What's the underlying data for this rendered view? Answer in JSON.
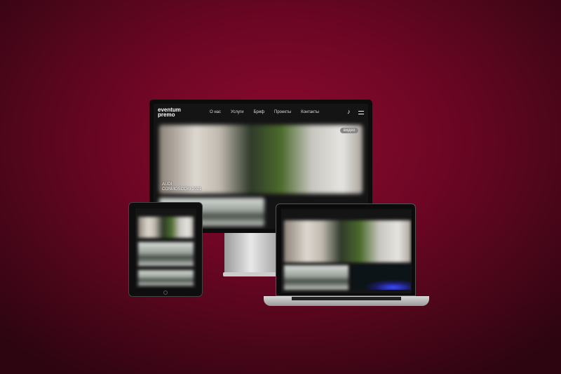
{
  "site": {
    "logo": "eventum premo",
    "nav": [
      "О нас",
      "Услуги",
      "Бриф",
      "Проекты",
      "Контакты"
    ],
    "hero_caption_line1": "AUDI",
    "hero_caption_line2": "COSMOSCOW 2021",
    "badge": "видео",
    "music_icon": "music-note-icon",
    "menu_icon": "hamburger-menu-icon"
  },
  "colors": {
    "background": "#7a0828",
    "screen": "#141414"
  }
}
